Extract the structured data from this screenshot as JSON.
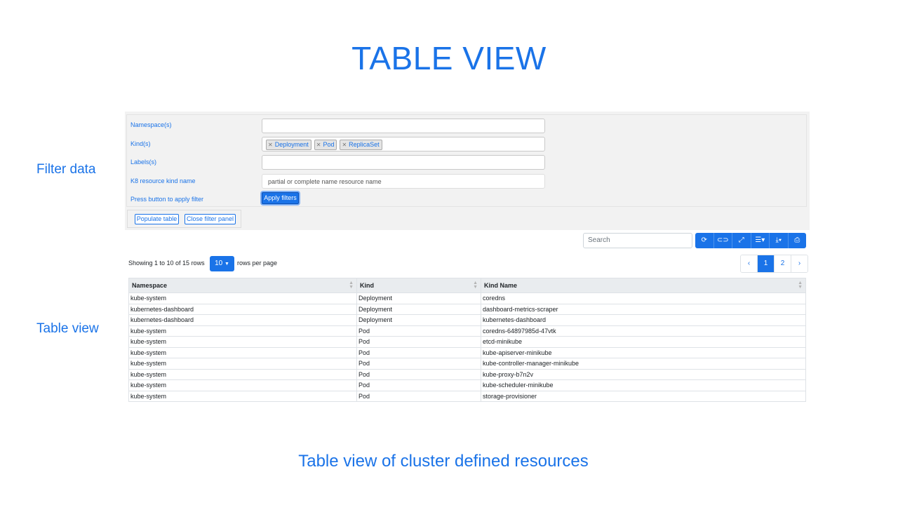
{
  "slide": {
    "title": "TABLE VIEW",
    "label_filter": "Filter data",
    "label_table": "Table view",
    "caption": "Table view of cluster defined resources"
  },
  "filter": {
    "namespace_label": "Namespace(s)",
    "namespace_value": "",
    "kind_label": "Kind(s)",
    "kinds": [
      "Deployment",
      "Pod",
      "ReplicaSet"
    ],
    "labels_label": "Labels(s)",
    "labels_value": "",
    "name_label": "K8 resource kind name",
    "name_placeholder": "partial or complete name resource name",
    "apply_label": "Press button to apply filter",
    "apply_button": "Apply filters",
    "populate_button": "Populate table",
    "close_button": "Close filter panel"
  },
  "toolbar": {
    "search_placeholder": "Search",
    "icons": [
      "refresh-icon",
      "toggle-icon",
      "fullscreen-icon",
      "columns-icon",
      "export-icon",
      "print-icon"
    ]
  },
  "pagination": {
    "showing": "Showing 1 to 10 of 15 rows",
    "rows_per_page": "10",
    "rows_per_page_label": "rows per page",
    "prev": "‹",
    "pages": [
      "1",
      "2"
    ],
    "next": "›"
  },
  "table": {
    "headers": [
      "Namespace",
      "Kind",
      "Kind Name"
    ],
    "rows": [
      [
        "kube-system",
        "Deployment",
        "coredns"
      ],
      [
        "kubernetes-dashboard",
        "Deployment",
        "dashboard-metrics-scraper"
      ],
      [
        "kubernetes-dashboard",
        "Deployment",
        "kubernetes-dashboard"
      ],
      [
        "kube-system",
        "Pod",
        "coredns-64897985d-47vtk"
      ],
      [
        "kube-system",
        "Pod",
        "etcd-minikube"
      ],
      [
        "kube-system",
        "Pod",
        "kube-apiserver-minikube"
      ],
      [
        "kube-system",
        "Pod",
        "kube-controller-manager-minikube"
      ],
      [
        "kube-system",
        "Pod",
        "kube-proxy-b7n2v"
      ],
      [
        "kube-system",
        "Pod",
        "kube-scheduler-minikube"
      ],
      [
        "kube-system",
        "Pod",
        "storage-provisioner"
      ]
    ]
  },
  "colors": {
    "accent": "#1a73e8",
    "panel": "#f2f2f2"
  }
}
